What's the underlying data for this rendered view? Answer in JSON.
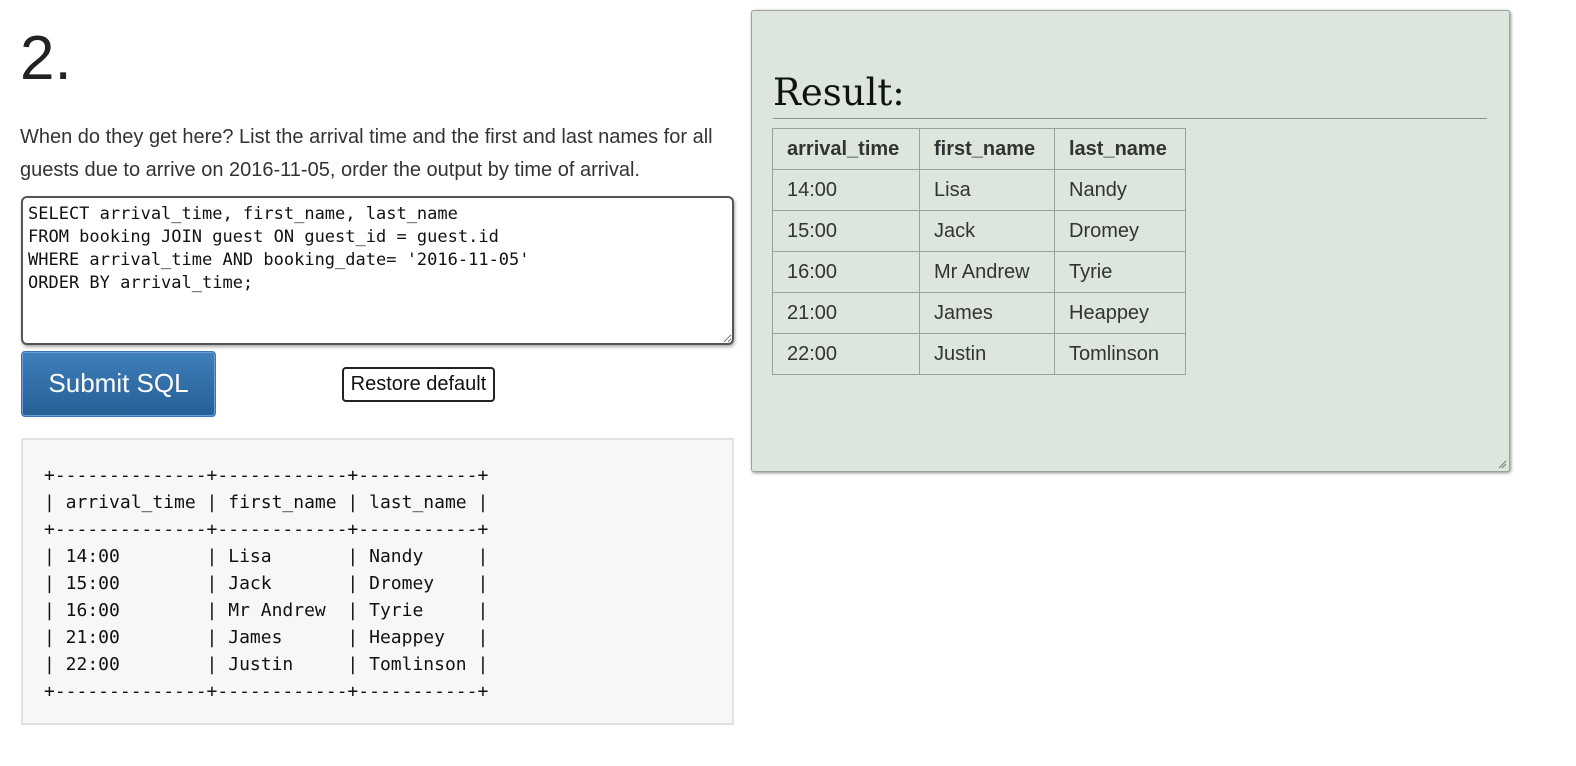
{
  "question": {
    "number": "2.",
    "text": "When do they get here? List the arrival time and the first and last names for all guests due to arrive on 2016-11-05, order the output by time of arrival."
  },
  "editor": {
    "sql": "SELECT arrival_time, first_name, last_name\nFROM booking JOIN guest ON guest_id = guest.id\nWHERE arrival_time AND booking_date= '2016-11-05'\nORDER BY arrival_time;"
  },
  "buttons": {
    "submit_label": "Submit SQL",
    "restore_label": "Restore default"
  },
  "text_output": "+--------------+------------+-----------+\n| arrival_time | first_name | last_name |\n+--------------+------------+-----------+\n| 14:00        | Lisa       | Nandy     |\n| 15:00        | Jack       | Dromey    |\n| 16:00        | Mr Andrew  | Tyrie     |\n| 21:00        | James      | Heappey   |\n| 22:00        | Justin     | Tomlinson |\n+--------------+------------+-----------+",
  "result": {
    "title": "Result:",
    "columns": [
      "arrival_time",
      "first_name",
      "last_name"
    ],
    "rows": [
      [
        "14:00",
        "Lisa",
        "Nandy"
      ],
      [
        "15:00",
        "Jack",
        "Dromey"
      ],
      [
        "16:00",
        "Mr Andrew",
        "Tyrie"
      ],
      [
        "21:00",
        "James",
        "Heappey"
      ],
      [
        "22:00",
        "Justin",
        "Tomlinson"
      ]
    ]
  },
  "colors": {
    "result_background": "#dce6dc",
    "submit_button": "#2f6ea8",
    "ascii_background": "#f7f7f7"
  }
}
